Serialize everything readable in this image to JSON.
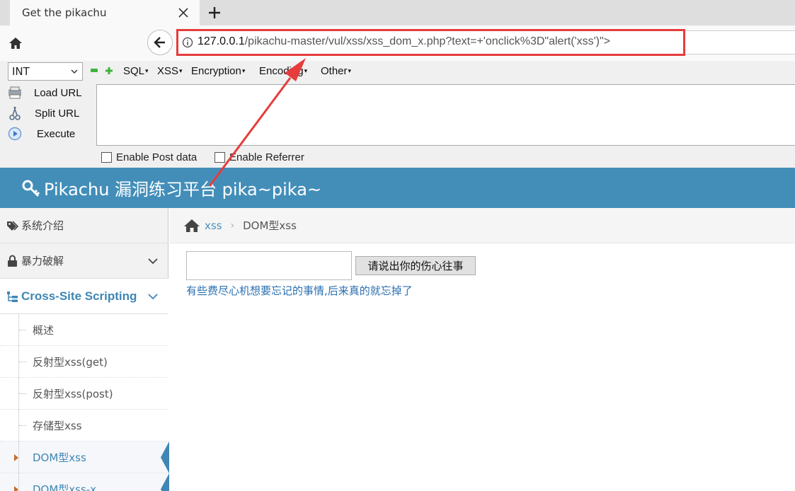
{
  "browser": {
    "tab_title": "Get the pikachu",
    "url_host": "127.0.0.1",
    "url_rest": "/pikachu-master/vul/xss/xss_dom_x.php?text=+'onclick%3D\"alert('xss')\">"
  },
  "hackbar": {
    "select_value": "INT",
    "menus": [
      "SQL",
      "XSS",
      "Encryption",
      "Encoding",
      "Other"
    ],
    "actions": [
      "Load URL",
      "Split URL",
      "Execute"
    ],
    "checks": [
      "Enable Post data",
      "Enable Referrer"
    ]
  },
  "site": {
    "title": "Pikachu 漏洞练习平台 pika~pika~"
  },
  "sidebar": {
    "sections": [
      "系统介绍",
      "暴力破解",
      "Cross-Site Scripting"
    ],
    "subitems": [
      "概述",
      "反射型xss(get)",
      "反射型xss(post)",
      "存储型xss",
      "DOM型xss",
      "DOM型xss-x"
    ]
  },
  "breadcrumb": {
    "link": "xss",
    "current": "DOM型xss"
  },
  "main": {
    "button_label": "请说出你的伤心往事",
    "link_text": "有些费尽心机想要忘记的事情,后来真的就忘掉了"
  },
  "colors": {
    "header": "#438eb9",
    "annotation": "#e63c3c",
    "accent": "#3f86b4"
  }
}
